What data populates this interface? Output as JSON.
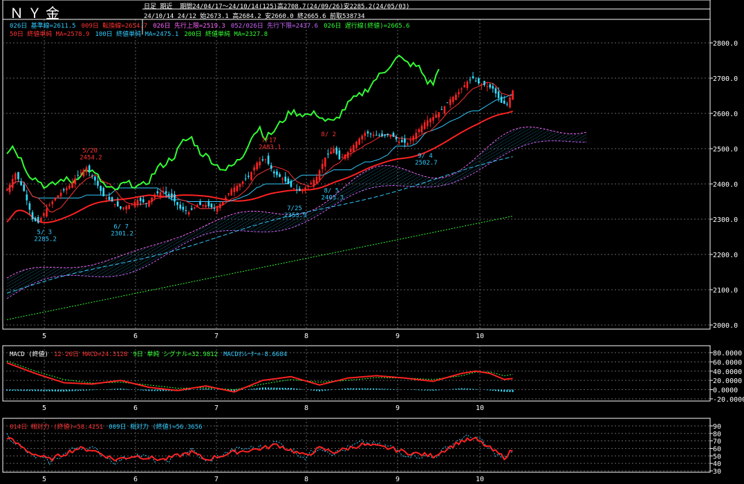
{
  "header": {
    "title": "ＮＹ金",
    "mode": "日足 期近",
    "period": "期間24/04/17～24/10/14(125)高2708.7(24/09/26)安2285.2(24/05/03)",
    "quote": "24/10/14 24/12 始2673.1 高2684.2 安2660.0 終2665.6 前取538734"
  },
  "legend": {
    "line1": [
      {
        "text": "026日 基準線=2611.5",
        "color": "#33ccff"
      },
      {
        "text": "009日 転換線=2654.7",
        "color": "#ff3333"
      },
      {
        "text": "026日 先行上限=2519.3",
        "color": "#ff66ff"
      },
      {
        "text": "052/026日 先行下限=2437.6",
        "color": "#cc66ff"
      },
      {
        "text": "026日 遅行線(終値)=2665.6",
        "color": "#33ff33"
      }
    ],
    "line2": [
      {
        "text": "50日 終値単純 MA=2578.9",
        "color": "#ff3333"
      },
      {
        "text": "100日 終値単純 MA=2475.1",
        "color": "#33ccff"
      },
      {
        "text": "200日 終値単純 MA=2327.8",
        "color": "#33ff33"
      }
    ],
    "macd": [
      {
        "text": "MACD (終値)",
        "color": "#ffffff"
      },
      {
        "text": "12-26日 MACD=24.3128",
        "color": "#ff3333"
      },
      {
        "text": "9日 単純 シグナル=32.9812",
        "color": "#33ff33"
      },
      {
        "text": "MACDｵｼﾚｰﾀｰ=-8.6684",
        "color": "#33ccff"
      }
    ],
    "rsi": [
      {
        "text": "014日 相対力 (終値)=58.4251",
        "color": "#ff3333"
      },
      {
        "text": "009日 相対力 (終値)=56.3656",
        "color": "#33ccff"
      }
    ]
  },
  "colors": {
    "up": "#ff2222",
    "down": "#33ddff",
    "grid": "#666666",
    "axis": "#ffffff"
  },
  "chart_data": [
    {
      "type": "candlestick",
      "name": "price",
      "x_ticks": [
        "5",
        "6",
        "7",
        "8",
        "9",
        "10"
      ],
      "ylim": [
        2000,
        2850
      ],
      "yticks": [
        2000,
        2100,
        2200,
        2300,
        2400,
        2500,
        2600,
        2700,
        2800
      ],
      "ytick_labels": [
        "2000.0",
        "2100.0",
        "2200.0",
        "2300.0",
        "2400.0",
        "2500.0",
        "2600.0",
        "2700.0",
        "2800.0"
      ],
      "anchors": [
        [
          0,
          2382
        ],
        [
          3,
          2430
        ],
        [
          6,
          2380
        ],
        [
          9,
          2300
        ],
        [
          11,
          2290
        ],
        [
          14,
          2330
        ],
        [
          17,
          2360
        ],
        [
          19,
          2375
        ],
        [
          22,
          2395
        ],
        [
          25,
          2425
        ],
        [
          28,
          2447
        ],
        [
          31,
          2410
        ],
        [
          34,
          2365
        ],
        [
          37,
          2350
        ],
        [
          40,
          2330
        ],
        [
          43,
          2340
        ],
        [
          46,
          2355
        ],
        [
          49,
          2345
        ],
        [
          52,
          2370
        ],
        [
          55,
          2380
        ],
        [
          58,
          2360
        ],
        [
          61,
          2330
        ],
        [
          64,
          2320
        ],
        [
          67,
          2340
        ],
        [
          70,
          2340
        ],
        [
          73,
          2330
        ],
        [
          76,
          2350
        ],
        [
          79,
          2385
        ],
        [
          82,
          2400
        ],
        [
          85,
          2420
        ],
        [
          88,
          2460
        ],
        [
          91,
          2470
        ],
        [
          94,
          2430
        ],
        [
          97,
          2415
        ],
        [
          100,
          2392
        ],
        [
          103,
          2380
        ],
        [
          106,
          2395
        ],
        [
          109,
          2420
        ],
        [
          112,
          2475
        ],
        [
          115,
          2500
        ],
        [
          117,
          2470
        ],
        [
          120,
          2490
        ],
        [
          123,
          2520
        ],
        [
          126,
          2545
        ],
        [
          129,
          2540
        ],
        [
          132,
          2535
        ],
        [
          135,
          2540
        ],
        [
          138,
          2520
        ],
        [
          141,
          2515
        ],
        [
          144,
          2545
        ],
        [
          147,
          2575
        ],
        [
          150,
          2590
        ],
        [
          153,
          2610
        ],
        [
          156,
          2640
        ],
        [
          159,
          2660
        ],
        [
          162,
          2690
        ],
        [
          164,
          2700
        ],
        [
          166,
          2685
        ],
        [
          168,
          2680
        ],
        [
          171,
          2670
        ],
        [
          174,
          2630
        ],
        [
          176,
          2625
        ],
        [
          178,
          2665
        ]
      ],
      "annotations": [
        {
          "text": "5/ 3",
          "sub": "2285.2",
          "i": 13,
          "y": 2285,
          "pos": "below"
        },
        {
          "text": "5/20",
          "sub": "2454.2",
          "i": 29,
          "y": 2454,
          "pos": "above"
        },
        {
          "text": "6/ 7",
          "sub": "2301.2",
          "i": 40,
          "y": 2301,
          "pos": "below"
        },
        {
          "text": "7/17",
          "sub": "2483.1",
          "i": 92,
          "y": 2483,
          "pos": "above"
        },
        {
          "text": "7/25",
          "sub": "2353.9",
          "i": 101,
          "y": 2353,
          "pos": "below"
        },
        {
          "text": "8/ 2",
          "sub": "",
          "i": 113,
          "y": 2500,
          "pos": "above"
        },
        {
          "text": "8/ 5",
          "sub": "2403.3",
          "i": 114,
          "y": 2403,
          "pos": "below"
        },
        {
          "text": "9/ 4",
          "sub": "2502.7",
          "i": 147,
          "y": 2502,
          "pos": "below"
        }
      ]
    },
    {
      "type": "line",
      "name": "macd",
      "ylim": [
        -25,
        82
      ],
      "yticks": [
        -20,
        0,
        20,
        40,
        60,
        80
      ],
      "ytick_labels": [
        "-20.0000",
        "0.0000",
        "20.0000",
        "40.0000",
        "60.0000",
        "80.0000"
      ],
      "macd_anchors": [
        [
          0,
          58
        ],
        [
          10,
          35
        ],
        [
          20,
          15
        ],
        [
          30,
          12
        ],
        [
          40,
          20
        ],
        [
          50,
          5
        ],
        [
          60,
          -2
        ],
        [
          70,
          8
        ],
        [
          80,
          -5
        ],
        [
          90,
          20
        ],
        [
          100,
          28
        ],
        [
          110,
          10
        ],
        [
          120,
          25
        ],
        [
          130,
          30
        ],
        [
          140,
          25
        ],
        [
          150,
          18
        ],
        [
          160,
          35
        ],
        [
          165,
          40
        ],
        [
          170,
          35
        ],
        [
          175,
          22
        ],
        [
          178,
          24
        ]
      ],
      "signal_anchors": [
        [
          0,
          62
        ],
        [
          10,
          40
        ],
        [
          20,
          22
        ],
        [
          30,
          14
        ],
        [
          40,
          16
        ],
        [
          50,
          10
        ],
        [
          60,
          3
        ],
        [
          70,
          4
        ],
        [
          80,
          0
        ],
        [
          90,
          12
        ],
        [
          100,
          22
        ],
        [
          110,
          16
        ],
        [
          120,
          20
        ],
        [
          130,
          26
        ],
        [
          140,
          25
        ],
        [
          150,
          22
        ],
        [
          160,
          30
        ],
        [
          165,
          38
        ],
        [
          170,
          38
        ],
        [
          175,
          30
        ],
        [
          178,
          33
        ]
      ]
    },
    {
      "type": "line",
      "name": "rsi",
      "ylim": [
        27,
        92
      ],
      "yticks": [
        30,
        40,
        50,
        60,
        70,
        80,
        90
      ],
      "ytick_labels": [
        "30",
        "40",
        "50",
        "60",
        "70",
        "80",
        "90"
      ],
      "rsi14_anchors": [
        [
          0,
          75
        ],
        [
          8,
          55
        ],
        [
          15,
          45
        ],
        [
          25,
          60
        ],
        [
          30,
          58
        ],
        [
          38,
          45
        ],
        [
          45,
          50
        ],
        [
          55,
          45
        ],
        [
          65,
          55
        ],
        [
          70,
          45
        ],
        [
          80,
          55
        ],
        [
          90,
          60
        ],
        [
          95,
          65
        ],
        [
          105,
          50
        ],
        [
          110,
          60
        ],
        [
          115,
          55
        ],
        [
          125,
          65
        ],
        [
          135,
          60
        ],
        [
          140,
          55
        ],
        [
          150,
          50
        ],
        [
          160,
          70
        ],
        [
          165,
          72
        ],
        [
          170,
          60
        ],
        [
          175,
          48
        ],
        [
          178,
          58
        ]
      ],
      "rsi9_anchors": [
        [
          0,
          78
        ],
        [
          8,
          52
        ],
        [
          15,
          42
        ],
        [
          25,
          62
        ],
        [
          30,
          60
        ],
        [
          38,
          42
        ],
        [
          45,
          52
        ],
        [
          55,
          42
        ],
        [
          65,
          58
        ],
        [
          70,
          42
        ],
        [
          80,
          58
        ],
        [
          90,
          62
        ],
        [
          95,
          68
        ],
        [
          105,
          48
        ],
        [
          110,
          62
        ],
        [
          115,
          53
        ],
        [
          125,
          68
        ],
        [
          135,
          62
        ],
        [
          140,
          52
        ],
        [
          150,
          48
        ],
        [
          160,
          74
        ],
        [
          165,
          76
        ],
        [
          170,
          58
        ],
        [
          175,
          46
        ],
        [
          178,
          56
        ]
      ]
    }
  ]
}
